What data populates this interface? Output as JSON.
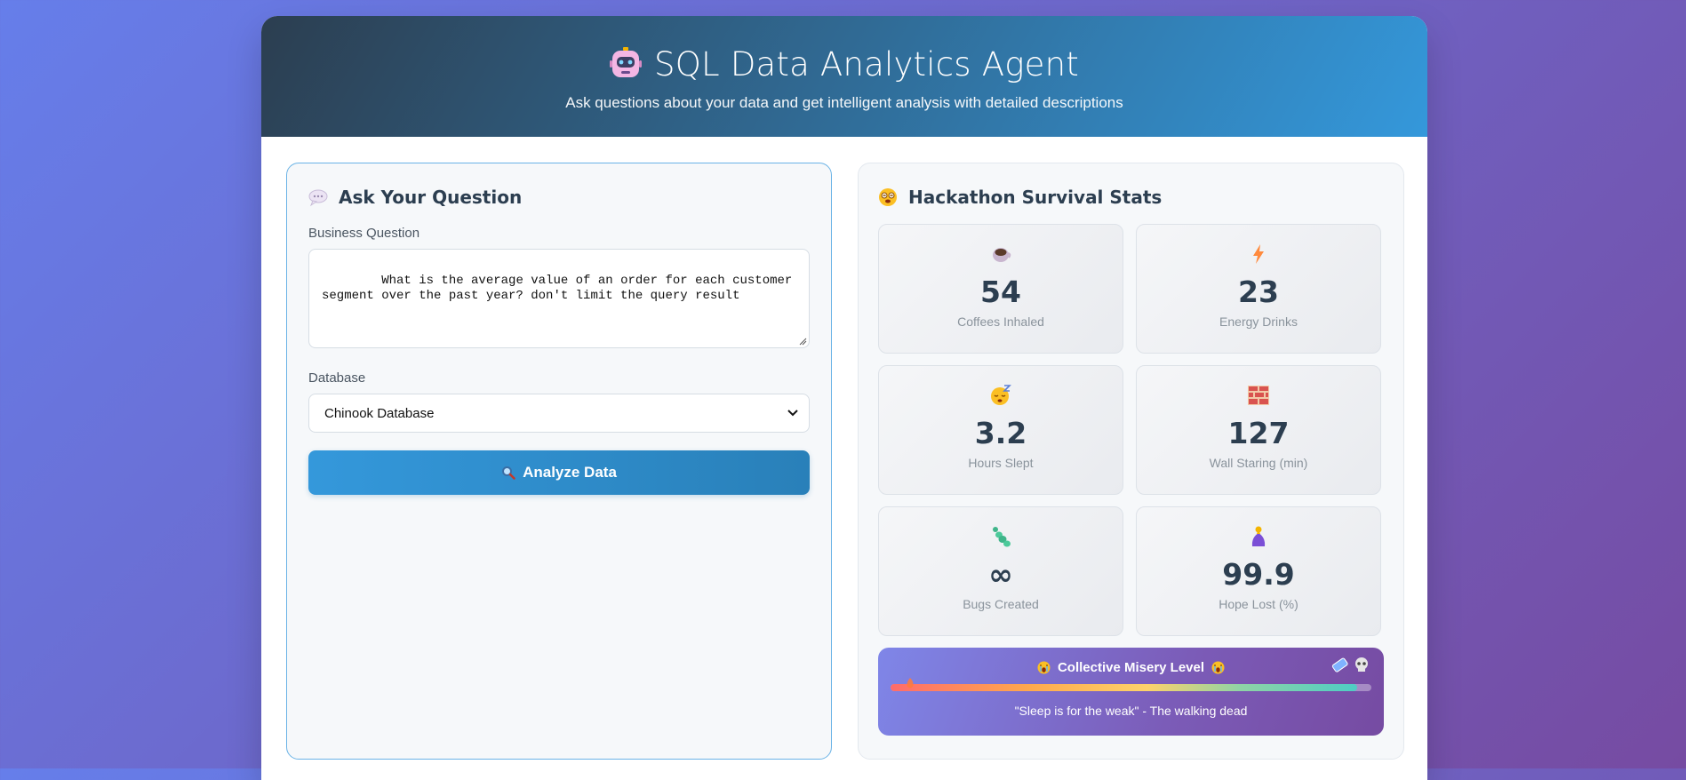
{
  "header": {
    "title": "SQL Data Analytics Agent",
    "subtitle": "Ask questions about your data and get intelligent analysis with detailed descriptions",
    "icon": "robot-icon"
  },
  "question_panel": {
    "title": "Ask Your Question",
    "icon": "speech-bubble-icon",
    "question_label": "Business Question",
    "question_value": "What is the average value of an order for each customer\nsegment over the past year? don't limit the query result",
    "database_label": "Database",
    "database_value": "Chinook Database",
    "analyze_button": "Analyze Data",
    "analyze_icon": "magnifier-icon"
  },
  "stats_panel": {
    "title": "Hackathon Survival Stats",
    "icon": "dizzy-face-icon",
    "stats": [
      {
        "value": "54",
        "label": "Coffees Inhaled",
        "icon": "coffee-icon"
      },
      {
        "value": "23",
        "label": "Energy Drinks",
        "icon": "lightning-icon"
      },
      {
        "value": "3.2",
        "label": "Hours Slept",
        "icon": "sleepy-face-icon"
      },
      {
        "value": "127",
        "label": "Wall Staring (min)",
        "icon": "brick-wall-icon"
      },
      {
        "value": "∞",
        "label": "Bugs Created",
        "icon": "bug-icon"
      },
      {
        "value": "99.9",
        "label": "Hope Lost (%)",
        "icon": "praying-hands-icon"
      }
    ],
    "misery": {
      "title": "Collective Misery Level",
      "quote": "\"Sleep is for the weak\" - The walking dead",
      "level_percent": 97,
      "accent": "#764ba2"
    }
  },
  "colors": {
    "background_start": "#667eea",
    "background_end": "#764ba2",
    "header_start": "#2c3e50",
    "header_end": "#3498db",
    "button": "#3498db"
  }
}
